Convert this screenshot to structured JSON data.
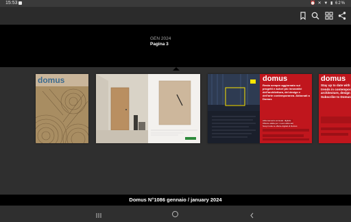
{
  "status_bar": {
    "time": "15:53",
    "battery": "62%",
    "icons": [
      "notification-icon",
      "alarm-icon",
      "mute-icon",
      "wifi-icon",
      "battery-icon"
    ]
  },
  "app_bar": {
    "actions": [
      "bookmark-icon",
      "search-icon",
      "grid-view-icon",
      "share-icon"
    ]
  },
  "header": {
    "issue_month": "GEN 2024",
    "page_label": "Pagina 3"
  },
  "pages": {
    "cover": {
      "magazine": "domus"
    },
    "spread2_left": {
      "magazine": "domus",
      "headline": "Resta sempre aggiornato sui progetti e autori più innovativi dell'architettura, del design e dell'arte contemporanea. Abbonati a Domus",
      "offer_lines": [
        "Abbonamento annuale: digitale",
        "Offerta valida per i nuovi abbonati",
        "Scopri tutte le offerte digitali di Domus"
      ]
    },
    "spread2_right": {
      "magazine": "domus",
      "headline": "Stay up to date with the key trends in contemporary architecture, design and art. Subscribe to Domus"
    }
  },
  "footer": {
    "issue_title": "Domus N°1086 gennaio / january 2024"
  },
  "nav_bar": {
    "buttons": [
      "recents-button",
      "home-button",
      "back-button"
    ]
  },
  "colors": {
    "domus_red": "#c0161d",
    "cover_bg": "#c9b59a",
    "wall_beige": "#ddd6ca",
    "header_black": "#000000",
    "canvas_gray": "#2f2f2f"
  }
}
